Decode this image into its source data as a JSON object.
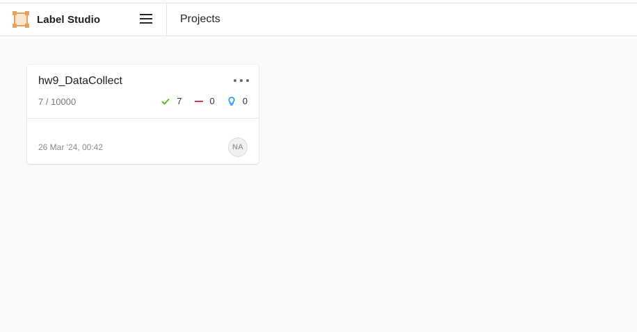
{
  "app": {
    "name": "Label Studio",
    "logo_icon": "label-studio-logo-icon",
    "logo_color": "#e8a15b",
    "menu_icon": "hamburger-menu-icon"
  },
  "header": {
    "page_title": "Projects"
  },
  "projects": [
    {
      "title": "hw9_DataCollect",
      "progress": "7 / 10000",
      "stats": {
        "completed": "7",
        "skipped": "0",
        "predictions": "0"
      },
      "stat_colors": {
        "completed": "#52c41a",
        "skipped": "#d9363e",
        "predictions": "#1890ff"
      },
      "created": "26 Mar '24, 00:42",
      "owner_initials": "NA",
      "menu_icon": "more-dots-icon"
    }
  ]
}
